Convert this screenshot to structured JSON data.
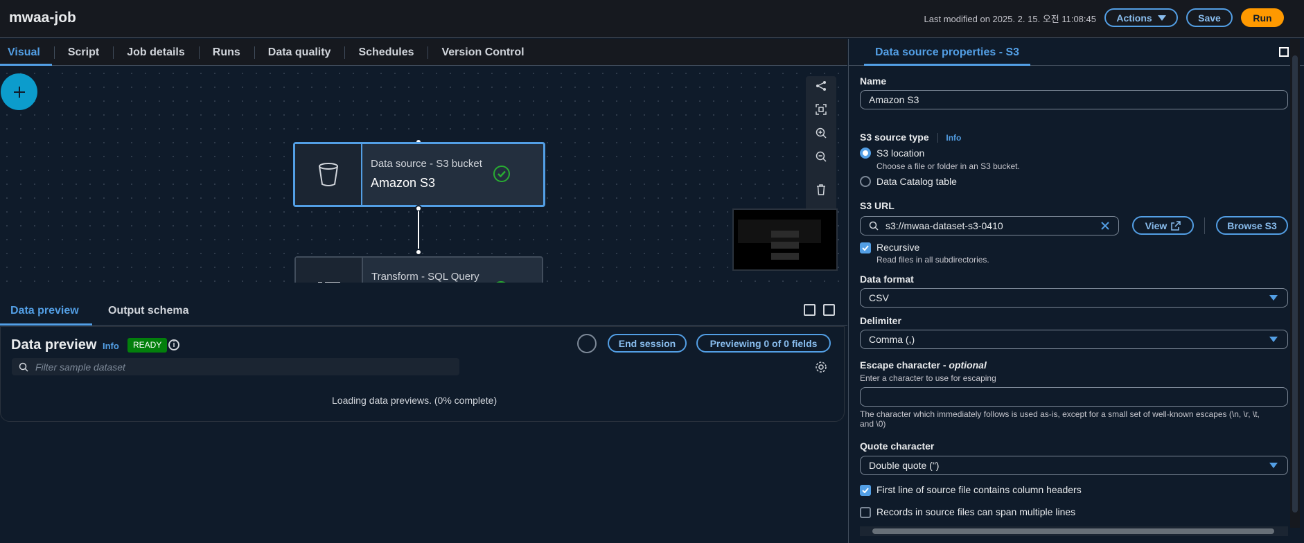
{
  "header": {
    "job_title": "mwaa-job",
    "last_modified": "Last modified on 2025. 2. 15. 오전 11:08:45",
    "actions_label": "Actions",
    "save_label": "Save",
    "run_label": "Run"
  },
  "tabs": [
    "Visual",
    "Script",
    "Job details",
    "Runs",
    "Data quality",
    "Schedules",
    "Version Control"
  ],
  "canvas": {
    "node1": {
      "subtitle": "Data source - S3 bucket",
      "title": "Amazon S3"
    },
    "node2": {
      "subtitle": "Transform - SQL Query"
    }
  },
  "bottom": {
    "tab_preview": "Data preview",
    "tab_schema": "Output schema",
    "title": "Data preview",
    "info": "Info",
    "status": "READY",
    "end_session": "End session",
    "previewing": "Previewing 0 of 0 fields",
    "filter_placeholder": "Filter sample dataset",
    "loading": "Loading data previews. (0% complete)"
  },
  "props": {
    "title": "Data source properties - S3",
    "name_label": "Name",
    "name_value": "Amazon S3",
    "source_type_label": "S3 source type",
    "info": "Info",
    "opt_s3": "S3 location",
    "opt_s3_desc": "Choose a file or folder in an S3 bucket.",
    "opt_catalog": "Data Catalog table",
    "url_label": "S3 URL",
    "url_value": "s3://mwaa-dataset-s3-0410",
    "view": "View",
    "browse": "Browse S3",
    "recursive": "Recursive",
    "recursive_desc": "Read files in all subdirectories.",
    "format_label": "Data format",
    "format_value": "CSV",
    "delimiter_label": "Delimiter",
    "delimiter_value": "Comma (,)",
    "escape_label": "Escape character - ",
    "escape_optional": "optional",
    "escape_hint": "Enter a character to use for escaping",
    "escape_note_1": "The character which immediately follows is used as-is, except for a small set of well-known escapes (\\n, \\r, \\t,",
    "escape_note_2": "and \\0)",
    "quote_label": "Quote character",
    "quote_value": "Double quote (\")",
    "headers_check": "First line of source file contains column headers",
    "multiline_check": "Records in source files can span multiple lines"
  }
}
